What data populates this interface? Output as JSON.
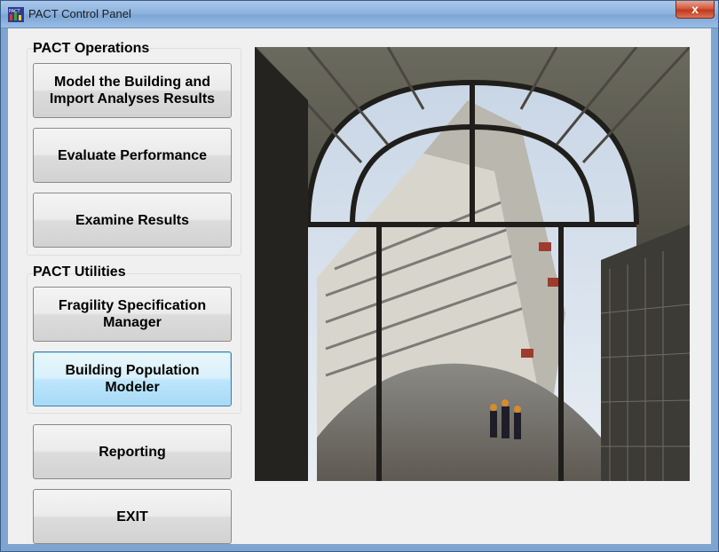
{
  "window": {
    "title": "PACT Control Panel",
    "close_label": "x",
    "icon_text": "PACT"
  },
  "operations": {
    "heading": "PACT Operations",
    "buttons": [
      "Model the Building and\nImport Analyses Results",
      "Evaluate Performance",
      "Examine Results"
    ]
  },
  "utilities": {
    "heading": "PACT Utilities",
    "buttons": [
      "Fragility Specification\nManager",
      "Building Population\nModeler"
    ]
  },
  "bottom_buttons": {
    "reporting": "Reporting",
    "exit": "EXIT"
  }
}
